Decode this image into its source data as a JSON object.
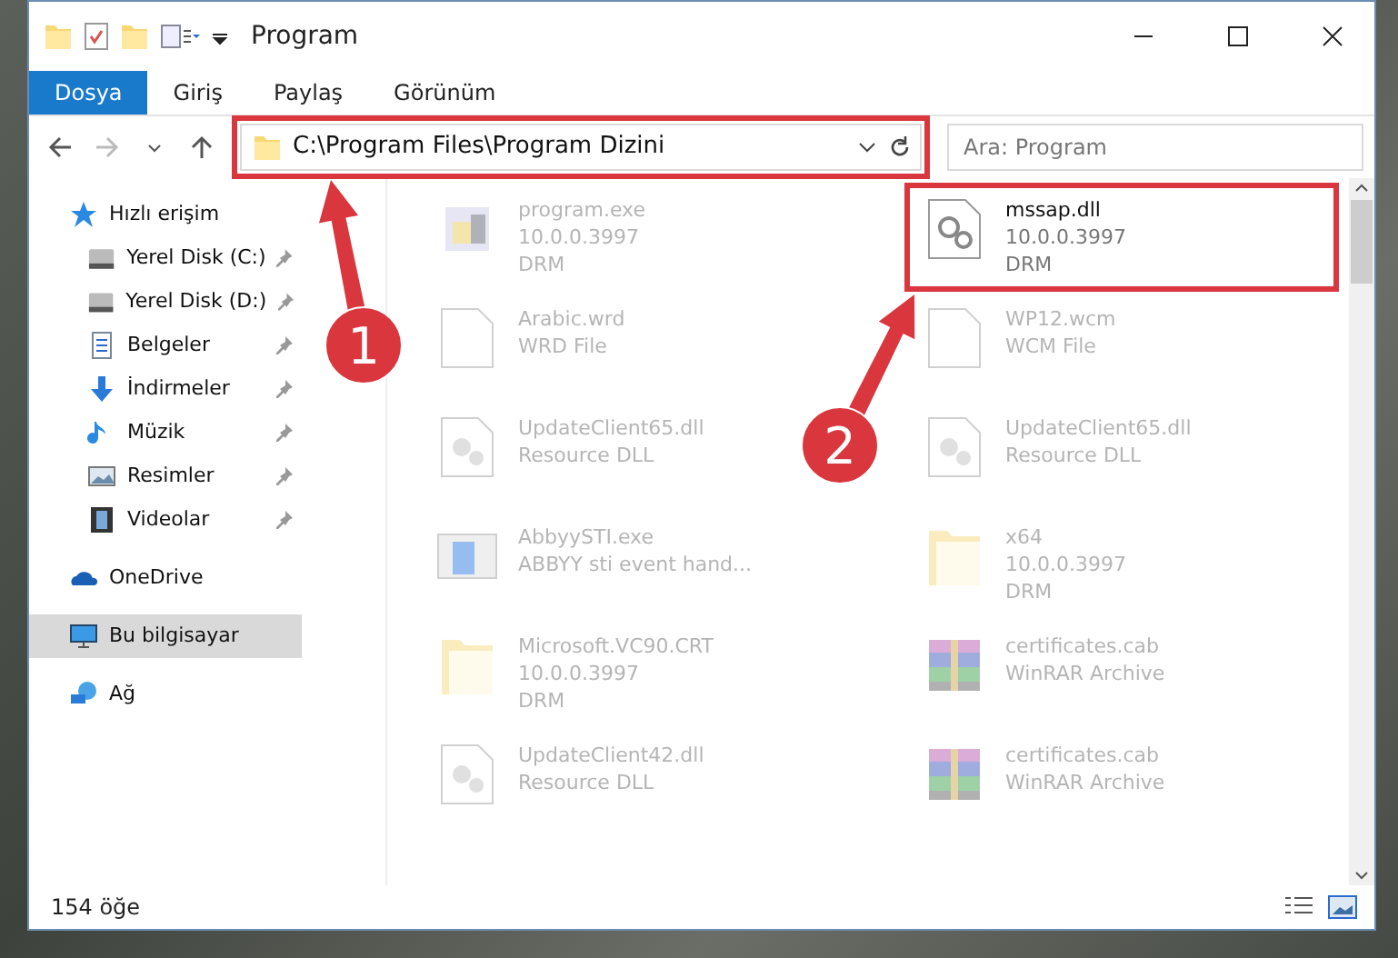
{
  "window": {
    "title": "Program"
  },
  "ribbon_tabs": [
    {
      "label": "Dosya",
      "selected": true
    },
    {
      "label": "Giriş",
      "selected": false
    },
    {
      "label": "Paylaş",
      "selected": false
    },
    {
      "label": "Görünüm",
      "selected": false
    }
  ],
  "address_bar": {
    "path": "C:\\Program Files\\Program Dizini"
  },
  "search": {
    "placeholder": "Ara: Program"
  },
  "sidebar": {
    "items": [
      {
        "label": "Hızlı erişim",
        "kind": "star",
        "selected": false,
        "children": [
          {
            "label": "Yerel Disk (C:)",
            "kind": "drive",
            "pinned": true,
            "selected": false
          },
          {
            "label": "Yerel Disk (D:)",
            "kind": "drive",
            "pinned": true,
            "selected": false
          },
          {
            "label": "Belgeler",
            "kind": "document",
            "pinned": true,
            "selected": false
          },
          {
            "label": "İndirmeler",
            "kind": "download",
            "pinned": true,
            "selected": false
          },
          {
            "label": "Müzik",
            "kind": "music",
            "pinned": true,
            "selected": false
          },
          {
            "label": "Resimler",
            "kind": "picture",
            "pinned": true,
            "selected": false
          },
          {
            "label": "Videolar",
            "kind": "video",
            "pinned": true,
            "selected": false
          }
        ]
      },
      {
        "label": "OneDrive",
        "kind": "cloud",
        "selected": false
      },
      {
        "label": "Bu bilgisayar",
        "kind": "computer",
        "selected": true
      },
      {
        "label": "Ağ",
        "kind": "network",
        "selected": false
      }
    ]
  },
  "files": [
    {
      "name": "program.exe",
      "details": [
        "10.0.0.3997",
        "DRM"
      ],
      "kind": "exe",
      "blurred": true
    },
    {
      "name": "mssap.dll",
      "details": [
        "10.0.0.3997",
        "DRM"
      ],
      "kind": "dll",
      "blurred": false
    },
    {
      "name": "Arabic.wrd",
      "details": [
        "WRD File"
      ],
      "kind": "file",
      "blurred": true
    },
    {
      "name": "WP12.wcm",
      "details": [
        "WCM File"
      ],
      "kind": "file",
      "blurred": true
    },
    {
      "name": "UpdateClient65.dll",
      "details": [
        "Resource DLL"
      ],
      "kind": "resource",
      "blurred": true
    },
    {
      "name": "UpdateClient65.dll",
      "details": [
        "Resource DLL"
      ],
      "kind": "resource",
      "blurred": true
    },
    {
      "name": "AbbyySTI.exe",
      "details": [
        "ABBYY sti event hand..."
      ],
      "kind": "app",
      "blurred": true
    },
    {
      "name": "x64",
      "details": [
        "10.0.0.3997",
        "DRM"
      ],
      "kind": "folder",
      "blurred": true
    },
    {
      "name": "Microsoft.VC90.CRT",
      "details": [
        "10.0.0.3997",
        "DRM"
      ],
      "kind": "folder",
      "blurred": true
    },
    {
      "name": "certificates.cab",
      "details": [
        "WinRAR Archive"
      ],
      "kind": "archive",
      "blurred": true
    },
    {
      "name": "UpdateClient42.dll",
      "details": [
        "Resource DLL"
      ],
      "kind": "resource",
      "blurred": true
    },
    {
      "name": "certificates.cab",
      "details": [
        "WinRAR Archive"
      ],
      "kind": "archive",
      "blurred": true
    }
  ],
  "status_bar": {
    "count": "154 öğe"
  },
  "annotations": [
    {
      "label": "1"
    },
    {
      "label": "2"
    }
  ]
}
